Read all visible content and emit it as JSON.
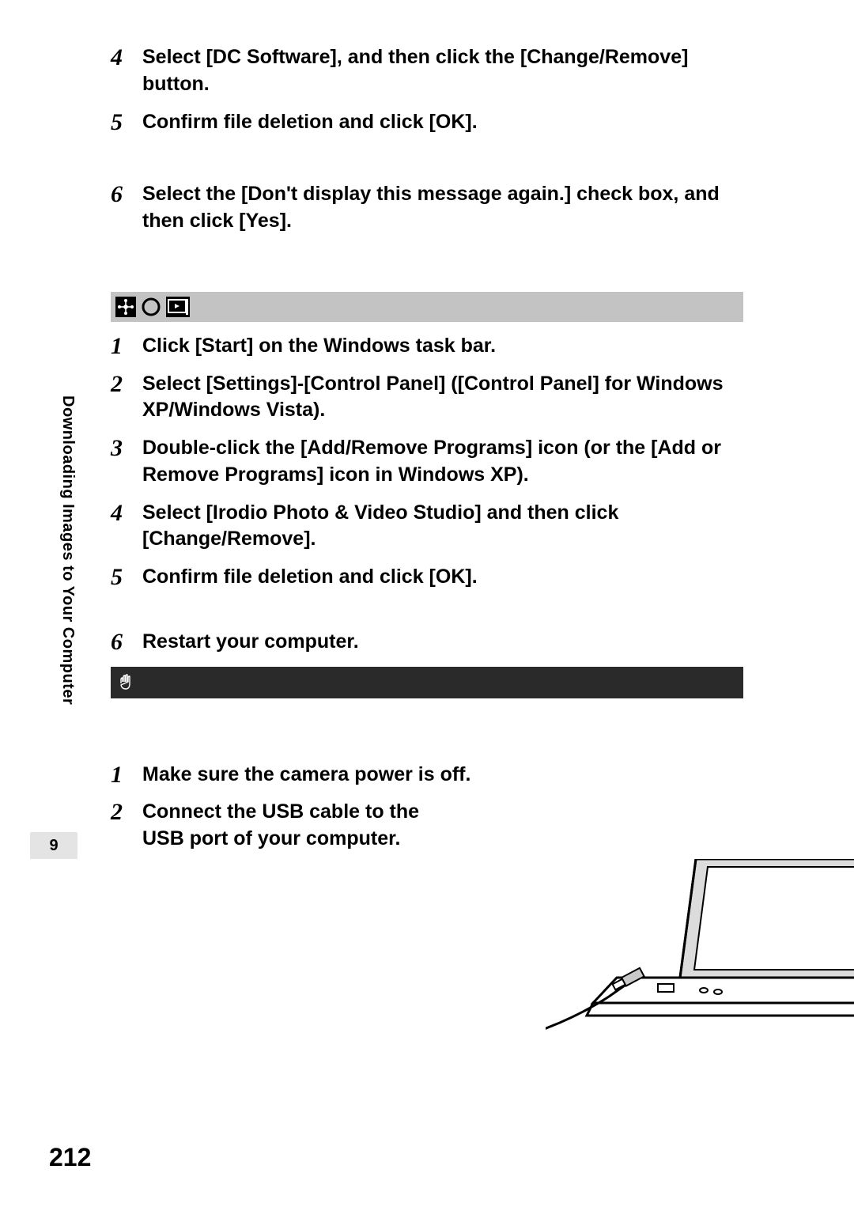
{
  "section_a": {
    "steps": [
      {
        "num": "4",
        "text": "Select [DC Software], and then click the [Change/Remove] button."
      },
      {
        "num": "5",
        "text": "Confirm file deletion and click [OK]."
      },
      {
        "num": "6",
        "text": "Select the [Don't display this message again.] check box, and then click [Yes]."
      }
    ]
  },
  "section_b": {
    "steps": [
      {
        "num": "1",
        "text": "Click [Start] on the Windows task bar."
      },
      {
        "num": "2",
        "text": "Select [Settings]-[Control Panel] ([Control Panel] for Windows XP/Windows Vista)."
      },
      {
        "num": "3",
        "text": "Double-click the [Add/Remove Programs] icon (or the [Add or Remove Programs] icon in Windows XP)."
      },
      {
        "num": "4",
        "text": "Select [Irodio Photo & Video Studio] and then click [Change/Remove]."
      },
      {
        "num": "5",
        "text": "Confirm file deletion and click [OK]."
      },
      {
        "num": "6",
        "text": "Restart your computer."
      }
    ]
  },
  "section_c": {
    "steps": [
      {
        "num": "1",
        "text": "Make sure the camera power is off."
      },
      {
        "num": "2",
        "text": "Connect the USB cable to the USB port of your computer."
      }
    ]
  },
  "sidebar": {
    "label": "Downloading Images to Your Computer",
    "tab": "9"
  },
  "page_number": "212"
}
